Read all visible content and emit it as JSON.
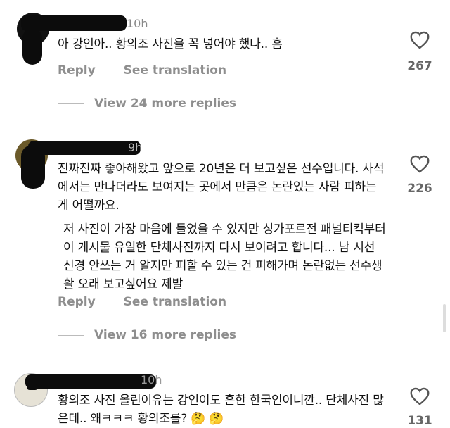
{
  "comments": [
    {
      "time": "10h",
      "lines": [
        "아 강인아.. 황의조 사진을 꼭 넣어야 했나.. 흠"
      ],
      "reply": "Reply",
      "translate": "See translation",
      "likes": "267",
      "view_more": "View 24 more replies"
    },
    {
      "time": "9h",
      "lines": [
        "진짜진짜 좋아해왔고 앞으로 20년은 더 보고싶은 선수입니다. 사석에서는 만나더라도 보여지는 곳에서 만큼은 논란있는 사람 피하는 게 어떨까요.",
        "저 사진이 가장 마음에 들었을 수 있지만 싱가포르전 패널티킥부터 이 게시물 유일한 단체사진까지 다시 보이려고 합니다... 남 시선 신경 안쓰는 거 알지만 피할 수 있는 건 피해가며 논란없는 선수생활 오래 보고싶어요 제발"
      ],
      "reply": "Reply",
      "translate": "See translation",
      "likes": "226",
      "view_more": "View 16 more replies"
    },
    {
      "time": "10h",
      "lines": [
        "황의조 사진 올린이유는 강인이도 흔한 한국인이니깐.. 단체사진 많은데.. 왜ㅋㅋㅋ 황의조를? 🤔 🤔"
      ],
      "likes": "131"
    }
  ]
}
